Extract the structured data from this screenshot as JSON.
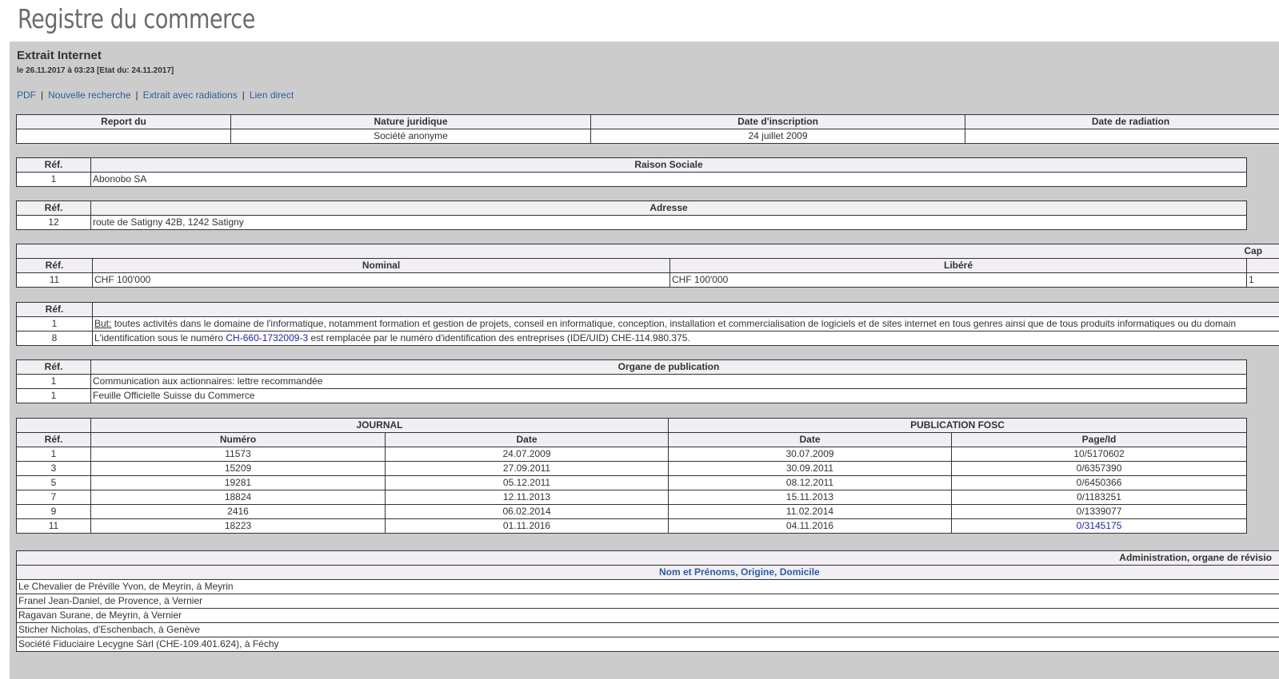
{
  "page": {
    "title": "Registre du commerce"
  },
  "extract": {
    "title": "Extrait Internet",
    "date_line": "le 26.11.2017 à 03:23 [Etat du: 24.11.2017]"
  },
  "links": [
    {
      "label": "PDF"
    },
    {
      "label": "Nouvelle recherche"
    },
    {
      "label": "Extrait avec radiations"
    },
    {
      "label": "Lien direct"
    }
  ],
  "summary": {
    "headers": [
      "Report du",
      "Nature juridique",
      "Date d'inscription",
      "Date de radiation"
    ],
    "row": [
      "",
      "Société anonyme",
      "24 juillet 2009",
      ""
    ]
  },
  "raison_sociale": {
    "ref_header": "Réf.",
    "header": "Raison Sociale",
    "rows": [
      {
        "ref": "1",
        "value": "Abonobo SA"
      }
    ]
  },
  "adresse": {
    "ref_header": "Réf.",
    "header": "Adresse",
    "rows": [
      {
        "ref": "12",
        "value": "route de Satigny 42B, 1242 Satigny"
      }
    ]
  },
  "capital": {
    "group_header": "Cap",
    "ref_header": "Réf.",
    "headers": [
      "Nominal",
      "Libéré"
    ],
    "rows": [
      {
        "ref": "11",
        "nominal": "CHF 100'000",
        "libere": "CHF 100'000",
        "extra": "1"
      }
    ]
  },
  "but": {
    "ref_header": "Réf.",
    "rows": [
      {
        "ref": "1",
        "label": "But:",
        "text": " toutes activités dans le domaine de l'informatique, notamment formation et gestion de projets, conseil en informatique, conception, installation et commercialisation de logiciels et de sites internet en tous genres ainsi que de tous produits informatiques ou du domain"
      },
      {
        "ref": "8",
        "text_before": "L'identification sous le numéro ",
        "link": "CH-660-1732009-3",
        "text_after": " est remplacée par le numéro d'identification des entreprises (IDE/UID) CHE-114.980.375."
      }
    ]
  },
  "publication": {
    "ref_header": "Réf.",
    "header": "Organe de publication",
    "rows": [
      {
        "ref": "1",
        "value": "Communication aux actionnaires: lettre recommandée"
      },
      {
        "ref": "1",
        "value": "Feuille Officielle Suisse du Commerce"
      }
    ]
  },
  "journal": {
    "group_journal": "JOURNAL",
    "group_fosc": "PUBLICATION FOSC",
    "headers": [
      "Réf.",
      "Numéro",
      "Date",
      "Date",
      "Page/Id"
    ],
    "rows": [
      {
        "ref": "1",
        "numero": "11573",
        "date": "24.07.2009",
        "fosc_date": "30.07.2009",
        "page": "10/5170602"
      },
      {
        "ref": "3",
        "numero": "15209",
        "date": "27.09.2011",
        "fosc_date": "30.09.2011",
        "page": "0/6357390"
      },
      {
        "ref": "5",
        "numero": "19281",
        "date": "05.12.2011",
        "fosc_date": "08.12.2011",
        "page": "0/6450366"
      },
      {
        "ref": "7",
        "numero": "18824",
        "date": "12.11.2013",
        "fosc_date": "15.11.2013",
        "page": "0/1183251"
      },
      {
        "ref": "9",
        "numero": "2416",
        "date": "06.02.2014",
        "fosc_date": "11.02.2014",
        "page": "0/1339077"
      },
      {
        "ref": "11",
        "numero": "18223",
        "date": "01.11.2016",
        "fosc_date": "04.11.2016",
        "page": "0/3145175"
      }
    ]
  },
  "administration": {
    "header": "Administration, organe de révisio",
    "subheader": "Nom et Prénoms, Origine, Domicile",
    "rows": [
      "Le Chevalier de Préville Yvon, de Meyrin, à Meyrin",
      "Franel Jean-Daniel, de Provence, à Vernier",
      "Ragavan Surane, de Meyrin, à Vernier",
      "Sticher Nicholas, d'Eschenbach, à Genève",
      "Société Fiduciaire Lecygne Sàrl (CHE-109.401.624), à Féchy"
    ]
  }
}
